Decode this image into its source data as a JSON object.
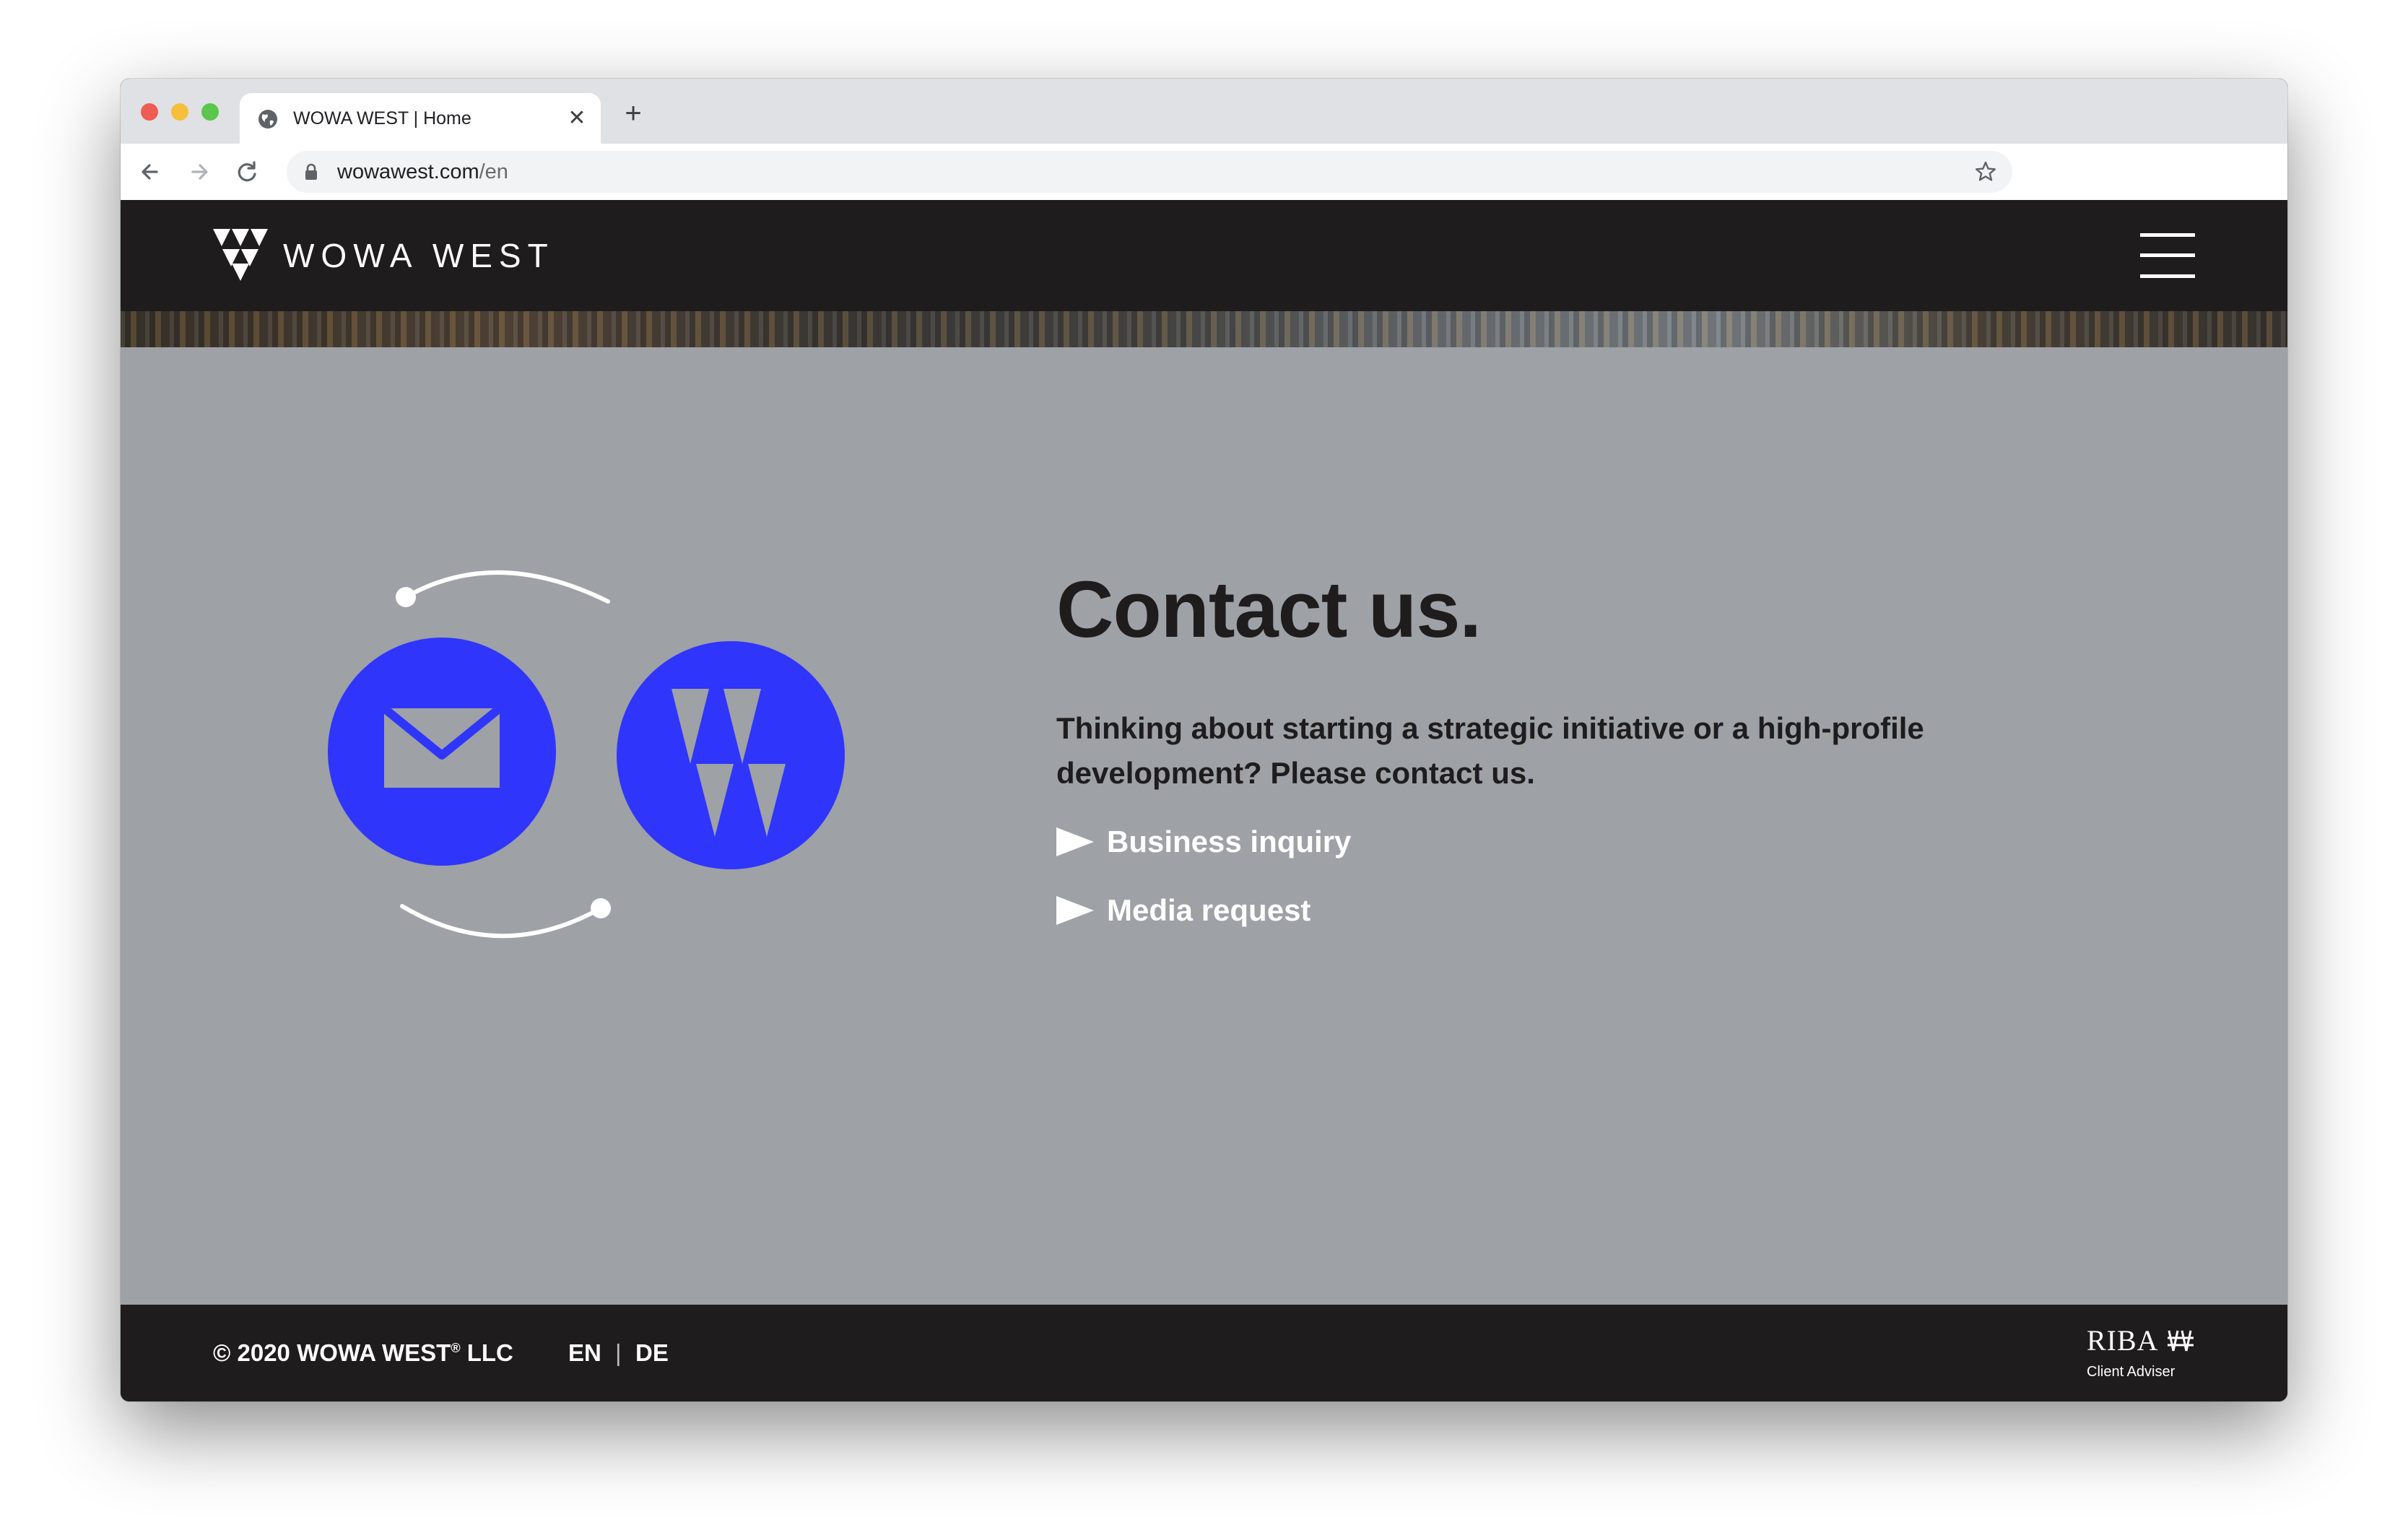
{
  "browser": {
    "tab_title": "WOWA WEST | Home",
    "tab_icon": "globe-icon",
    "close_glyph": "✕",
    "new_tab_glyph": "+",
    "url_domain": "wowawest.com",
    "url_path": "/en"
  },
  "site": {
    "logo_text": "WOWA WEST",
    "colors": {
      "header_bg": "#1e1c1d",
      "content_bg": "#9ea1a6",
      "accent_blue": "#2f35fa",
      "text_dark": "#1e1c1d"
    }
  },
  "contact": {
    "title": "Contact us.",
    "description": "Thinking about starting a strategic initiative or a high-profile development? Please contact us.",
    "links": [
      {
        "label": "Business inquiry"
      },
      {
        "label": "Media request"
      }
    ]
  },
  "footer": {
    "copyright_prefix": "© 2020 WOWA WEST",
    "copyright_reg": "®",
    "copyright_suffix": " LLC",
    "lang_en": "EN",
    "lang_sep": "|",
    "lang_de": "DE",
    "riba_name": "RIBA",
    "riba_sub": "Client Adviser"
  }
}
